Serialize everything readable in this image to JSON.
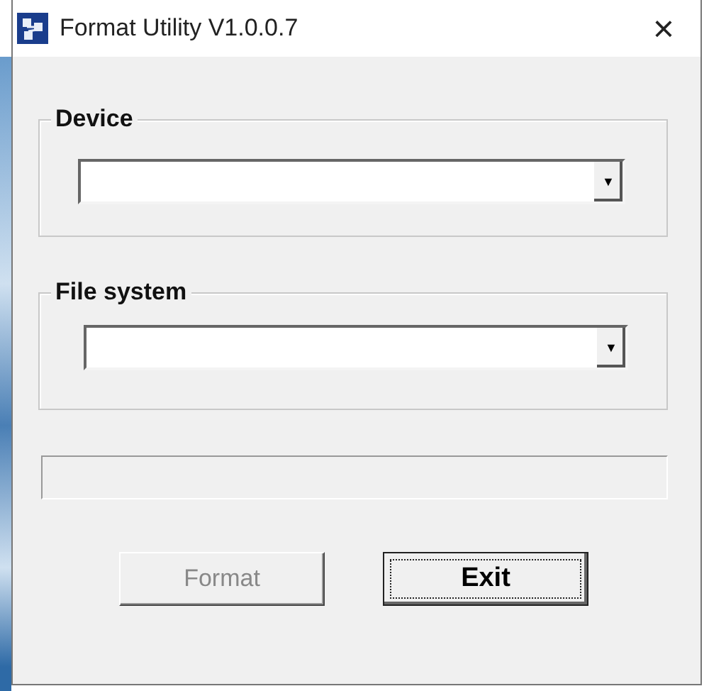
{
  "window": {
    "title": "Format Utility V1.0.0.7",
    "close": "×"
  },
  "groups": [
    {
      "label": "Device",
      "arrow": "▼"
    },
    {
      "label": "File system",
      "arrow": "▼"
    }
  ],
  "progress": {
    "level": 0
  },
  "buttons": [
    {
      "label": "Format",
      "disabled": true,
      "focused": false
    },
    {
      "label": "Exit",
      "disabled": false,
      "focused": true
    }
  ]
}
